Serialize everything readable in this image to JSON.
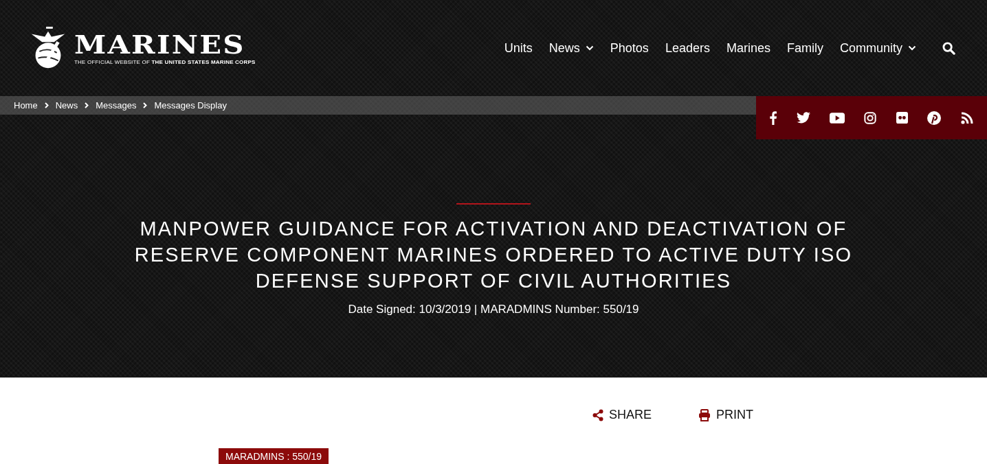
{
  "header": {
    "logo_title": "MARINES",
    "logo_subtitle": "THE OFFICIAL WEBSITE OF **THE UNITED STATES MARINE CORPS**",
    "nav": [
      {
        "label": "Units",
        "has_menu": false
      },
      {
        "label": "News",
        "has_menu": true
      },
      {
        "label": "Photos",
        "has_menu": false
      },
      {
        "label": "Leaders",
        "has_menu": false
      },
      {
        "label": "Marines",
        "has_menu": false
      },
      {
        "label": "Family",
        "has_menu": false
      },
      {
        "label": "Community",
        "has_menu": true
      }
    ]
  },
  "breadcrumbs": [
    "Home",
    "News",
    "Messages",
    "Messages Display"
  ],
  "hero": {
    "title": "MANPOWER GUIDANCE FOR ACTIVATION AND DEACTIVATION OF RESERVE COMPONENT MARINES ORDERED TO ACTIVE DUTY ISO DEFENSE SUPPORT OF CIVIL AUTHORITIES",
    "meta": "Date Signed: 10/3/2019 | MARADMINS Number: 550/19"
  },
  "actions": [
    {
      "kind": "share",
      "label": "SHARE"
    },
    {
      "kind": "print",
      "label": "PRINT"
    }
  ],
  "tag": "MARADMINS : 550/19"
}
